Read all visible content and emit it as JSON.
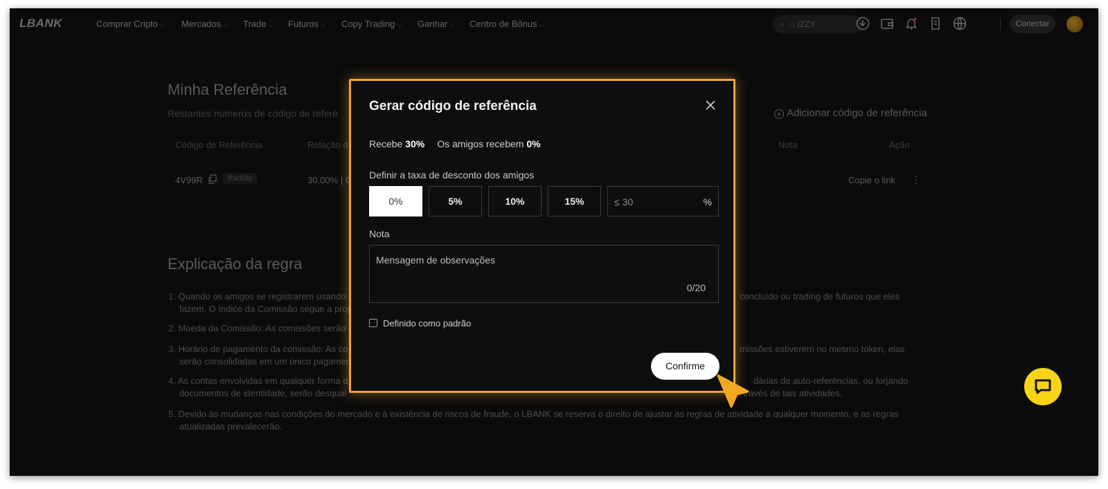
{
  "brand": "LBANK",
  "nav": [
    {
      "label": "Comprar Cripto",
      "dropdown": true
    },
    {
      "label": "Mercados",
      "dropdown": true
    },
    {
      "label": "Trade",
      "dropdown": true
    },
    {
      "label": "Futuros",
      "dropdown": true
    },
    {
      "label": "Copy Trading",
      "dropdown": true
    },
    {
      "label": "Ganhar",
      "dropdown": true
    },
    {
      "label": "Centro de Bônus",
      "dropdown": true
    }
  ],
  "search": {
    "placeholder": "IZZY"
  },
  "header": {
    "connect_label": "Conectar"
  },
  "page": {
    "title": "Minha Referência",
    "subtitle": "Restantes números de código de referê",
    "add_label": "Adicionar código de referência",
    "table": {
      "headers": {
        "code": "Código de Referência",
        "ratio": "Relação d",
        "note": "Nota",
        "action": "Ação"
      },
      "row": {
        "code": "4V99R",
        "badge": "Padrão",
        "ratio": "30.00% | C",
        "action": "Copie o link"
      }
    },
    "rules_title": "Explicação da regra",
    "rules": {
      "r1a": "1. Quando os amigos se registrarem usando s",
      "r1b": "fazem. O índice da Comissão segue a propo",
      "r1c": "concluído ou trading de futuros que eles",
      "r2": "2. Moeda da Comissão: As comissões serão e",
      "r3a": "3. Horário de pagamento da comissão: As co",
      "r3b": "serão consolidadas em um único pagamen",
      "r3c": "missões estiverem no mesmo token, elas",
      "r4a": "4. As contas envolvidas em qualquer forma d",
      "r4b": "documentos de identidade, serão desqual",
      "r4c": "dárias de auto-referências, ou forjando",
      "r4d": "través de tais atividades.",
      "r5a": "5. Devido às mudanças nas condições do mercado e à existência de riscos de fraude, o LBANK se reserva o direito de ajustar as regras de atividade a qualquer momento, e as regras",
      "r5b": "atualizadas prevalecerão."
    }
  },
  "modal": {
    "title": "Gerar código de referência",
    "receive_label": "Recebe",
    "receive_value": "30%",
    "friends_label": "Os amigos recebem",
    "friends_value": "0%",
    "rate_label": "Definir a taxa de desconto dos amigos",
    "rate_options": [
      "0%",
      "5%",
      "10%",
      "15%"
    ],
    "rate_selected": "0%",
    "rate_input_placeholder": "≤ 30",
    "rate_input_unit": "%",
    "note_label": "Nota",
    "note_placeholder": "Mensagem de observações",
    "note_counter": "0/20",
    "default_checkbox_label": "Definido como padrão",
    "confirm_label": "Confirme"
  },
  "colors": {
    "accent_border": "#f0a43a",
    "chat_button": "#f7d516",
    "cursor": "#f5a623"
  }
}
